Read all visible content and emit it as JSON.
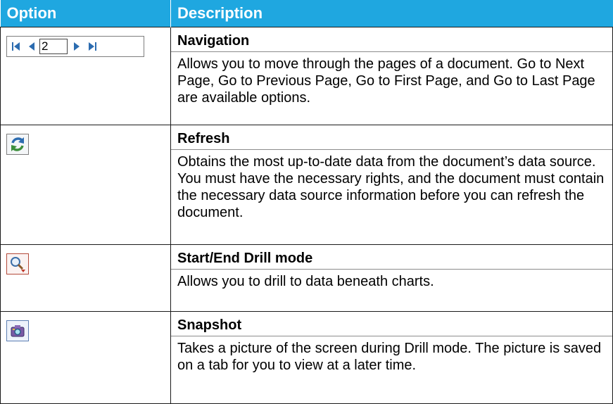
{
  "header": {
    "option": "Option",
    "description": "Description"
  },
  "rows": [
    {
      "title": "Navigation",
      "description": "Allows you to move through the pages of a document. Go to Next Page, Go to Previous Page, Go to First Page, and Go to Last Page are available options.",
      "control": {
        "page_value": "2",
        "icons": [
          "first-page-icon",
          "previous-page-icon",
          "next-page-icon",
          "last-page-icon"
        ]
      }
    },
    {
      "title": "Refresh",
      "description": "Obtains the most up-to-date data from the document’s data source. You must have the necessary rights, and the document must contain the necessary data source information before you can refresh the document.",
      "icon": "refresh-icon"
    },
    {
      "title": "Start/End Drill mode",
      "description": "Allows you to drill to data beneath charts.",
      "icon": "drill-magnifier-icon"
    },
    {
      "title": "Snapshot",
      "description": "Takes a picture of the screen during Drill mode. The picture is saved on a tab for you to view at a later time.",
      "icon": "camera-icon"
    }
  ],
  "colors": {
    "header_bg": "#1fa7e0",
    "header_text": "#ffffff",
    "icon_blue": "#2c6cb0"
  }
}
